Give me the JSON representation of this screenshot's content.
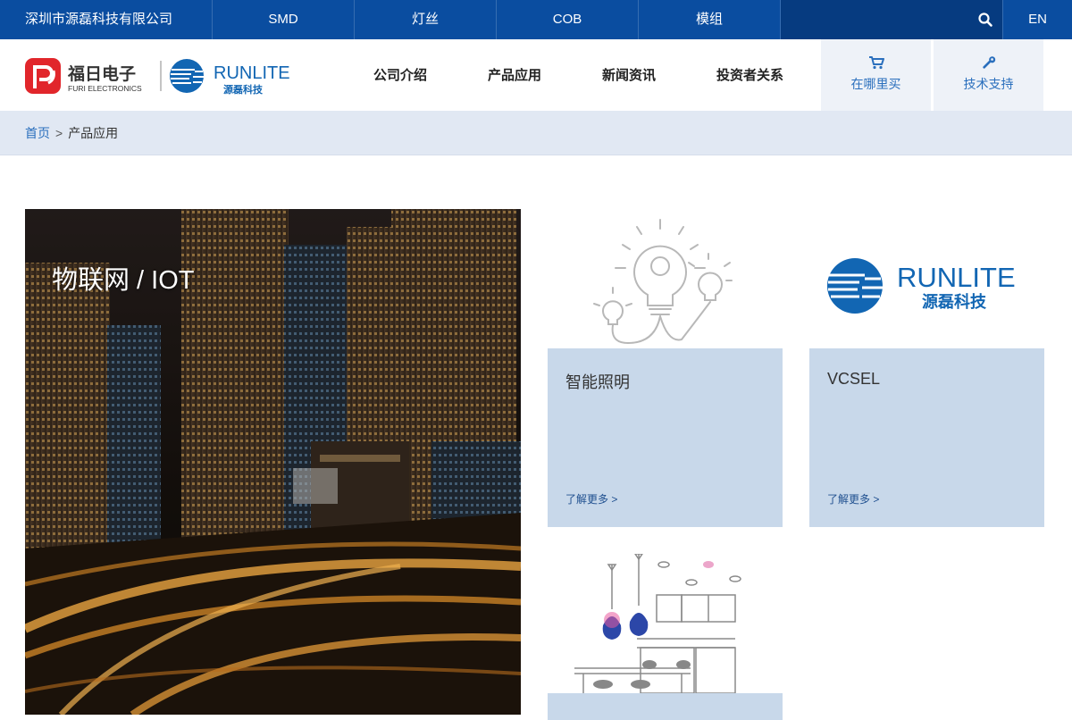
{
  "topbar": {
    "company": "深圳市源磊科技有限公司",
    "nav": [
      "SMD",
      "灯丝",
      "COB",
      "模组"
    ],
    "lang": "EN"
  },
  "header": {
    "logo": {
      "furi_cn": "福日电子",
      "furi_en": "FURI ELECTRONICS",
      "brand_en": "RUNLITE",
      "brand_cn": "源磊科技"
    },
    "nav": [
      "公司介绍",
      "产品应用",
      "新闻资讯",
      "投资者关系"
    ],
    "buttons": {
      "buy": "在哪里买",
      "support": "技术支持"
    }
  },
  "breadcrumb": {
    "home": "首页",
    "sep": ">",
    "current": "产品应用"
  },
  "hero": {
    "title": "物联网 / IOT"
  },
  "cards": [
    {
      "title": "智能照明",
      "more": "了解更多 >"
    },
    {
      "title": "VCSEL",
      "more": "了解更多 >",
      "brand_en": "RUNLITE",
      "brand_cn": "源磊科技"
    },
    {
      "title": "",
      "more": ""
    }
  ],
  "colors": {
    "primary": "#0a4da0",
    "accent": "#2a6fbd",
    "card": "#c8d8ea",
    "crumb": "#e1e8f3"
  }
}
